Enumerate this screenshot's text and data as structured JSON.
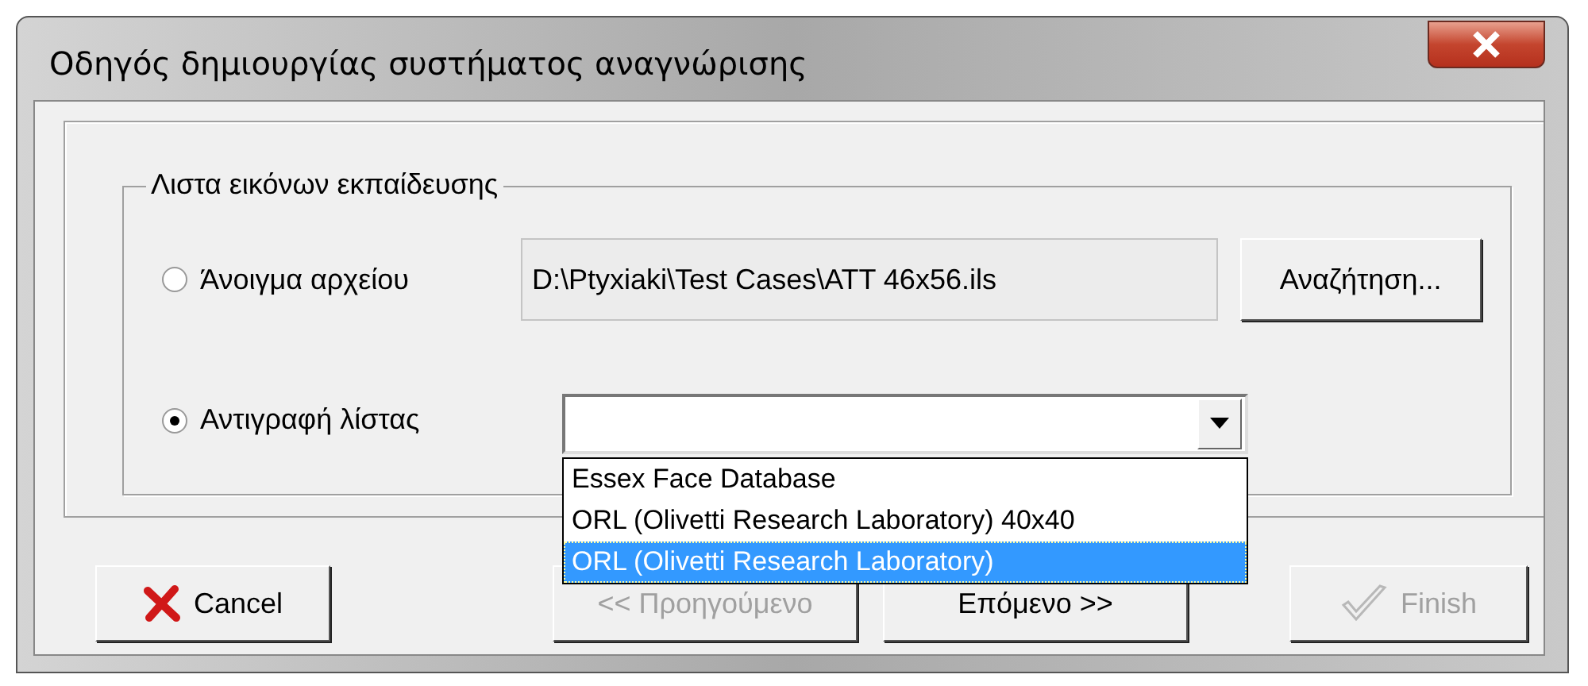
{
  "window": {
    "title": "Οδηγός δημιουργίας συστήματος αναγνώρισης"
  },
  "group": {
    "legend": "Λιστα εικόνων εκπαίδευσης"
  },
  "options": [
    {
      "kind": "file",
      "label": "Άνοιγμα αρχείου",
      "selected": false,
      "value": "D:\\Ptyxiaki\\Test Cases\\ATT 46x56.ils",
      "button": "Αναζήτηση..."
    },
    {
      "kind": "combo",
      "label": "Αντιγραφή λίστας",
      "selected": true
    }
  ],
  "dropdown": {
    "items": [
      {
        "label": "Essex  Face Database",
        "selected": false
      },
      {
        "label": "ORL (Olivetti Research Laboratory) 40x40",
        "selected": false
      },
      {
        "label": "ORL (Olivetti Research Laboratory)",
        "selected": true
      }
    ]
  },
  "buttons": [
    {
      "label": "Cancel",
      "kind": "cancel",
      "disabled": false
    },
    {
      "label": "<< Προηγούμενο",
      "kind": "back",
      "disabled": true
    },
    {
      "label": "Επόμενο >>",
      "kind": "next",
      "disabled": false
    },
    {
      "label": "Finish",
      "kind": "finish",
      "disabled": true
    }
  ]
}
